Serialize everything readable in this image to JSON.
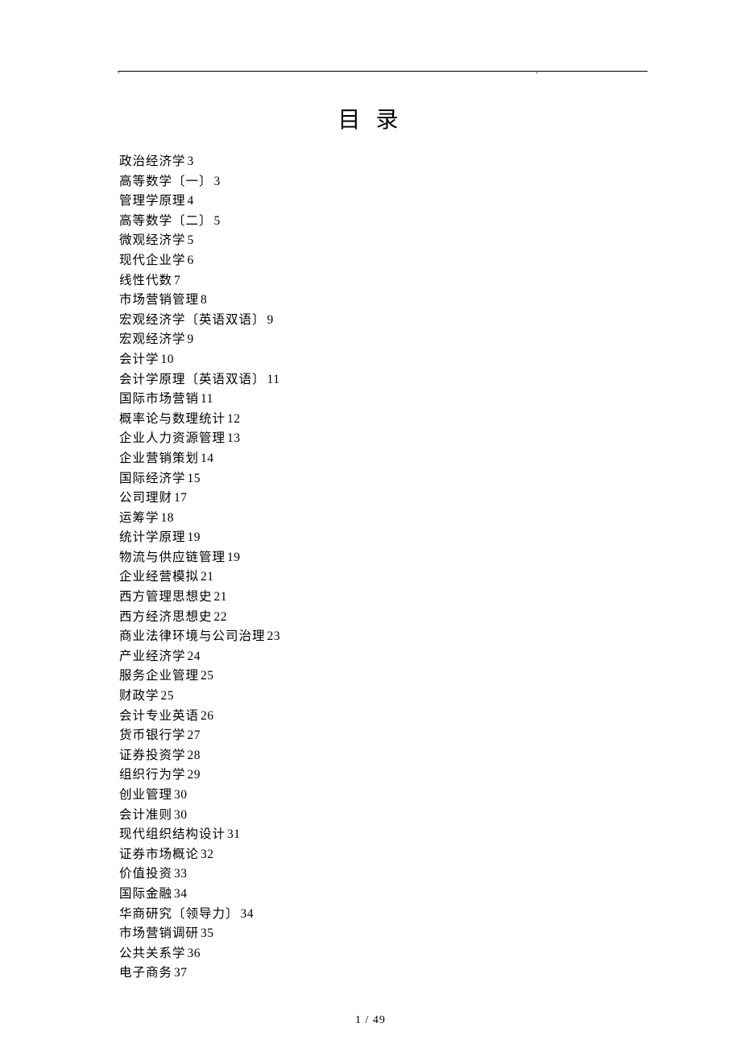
{
  "heading": "目 录",
  "toc": [
    {
      "title": "政治经济学",
      "page": "3"
    },
    {
      "title": "高等数学〔一〕",
      "page": "3"
    },
    {
      "title": "管理学原理",
      "page": "4"
    },
    {
      "title": "高等数学〔二〕",
      "page": "5"
    },
    {
      "title": "微观经济学",
      "page": "5"
    },
    {
      "title": "现代企业学",
      "page": "6"
    },
    {
      "title": "线性代数",
      "page": "7"
    },
    {
      "title": "市场营销管理",
      "page": "8"
    },
    {
      "title": "宏观经济学〔英语双语〕",
      "page": "9"
    },
    {
      "title": "宏观经济学",
      "page": "9"
    },
    {
      "title": "会计学",
      "page": "10"
    },
    {
      "title": "会计学原理〔英语双语〕",
      "page": "11"
    },
    {
      "title": "国际市场营销",
      "page": "11"
    },
    {
      "title": "概率论与数理统计",
      "page": "12"
    },
    {
      "title": "企业人力资源管理",
      "page": "13"
    },
    {
      "title": "企业营销策划",
      "page": "14"
    },
    {
      "title": "国际经济学",
      "page": "15"
    },
    {
      "title": "公司理财",
      "page": "17"
    },
    {
      "title": "运筹学",
      "page": "18"
    },
    {
      "title": "统计学原理",
      "page": "19"
    },
    {
      "title": "物流与供应链管理",
      "page": "19"
    },
    {
      "title": "企业经营模拟",
      "page": "21"
    },
    {
      "title": "西方管理思想史",
      "page": "21"
    },
    {
      "title": "西方经济思想史",
      "page": "22"
    },
    {
      "title": "商业法律环境与公司治理",
      "page": "23"
    },
    {
      "title": "产业经济学",
      "page": "24"
    },
    {
      "title": "服务企业管理",
      "page": "25"
    },
    {
      "title": "财政学",
      "page": "25"
    },
    {
      "title": "会计专业英语",
      "page": "26"
    },
    {
      "title": "货币银行学",
      "page": "27"
    },
    {
      "title": "证券投资学",
      "page": "28"
    },
    {
      "title": "组织行为学",
      "page": "29"
    },
    {
      "title": "创业管理",
      "page": "30"
    },
    {
      "title": "会计准则",
      "page": "30"
    },
    {
      "title": "现代组织结构设计",
      "page": "31"
    },
    {
      "title": "证券市场概论",
      "page": "32"
    },
    {
      "title": "价值投资",
      "page": "33"
    },
    {
      "title": "国际金融",
      "page": "34"
    },
    {
      "title": "华商研究〔领导力〕",
      "page": "34"
    },
    {
      "title": "市场营销调研",
      "page": "35"
    },
    {
      "title": "公共关系学",
      "page": "36"
    },
    {
      "title": "电子商务",
      "page": "37"
    }
  ],
  "footer": "1 / 49",
  "header_marks": {
    "left": ".",
    "right": "."
  }
}
